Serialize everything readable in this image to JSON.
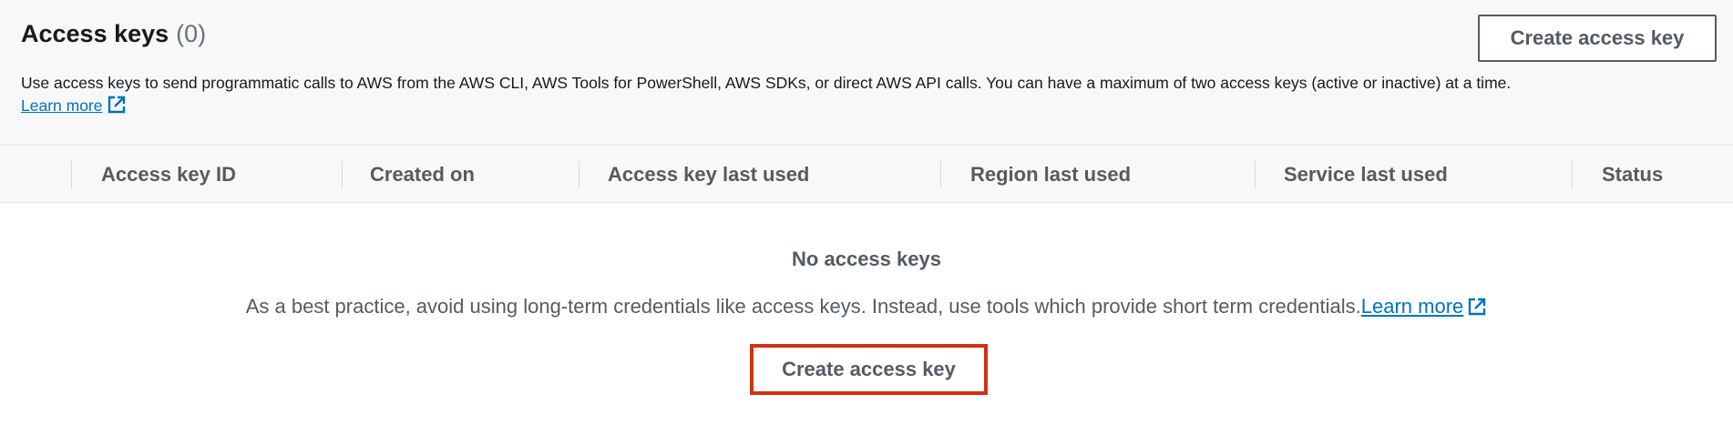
{
  "panel": {
    "title": "Access keys",
    "count": "(0)",
    "create_button_label": "Create access key",
    "description": "Use access keys to send programmatic calls to AWS from the AWS CLI, AWS Tools for PowerShell, AWS SDKs, or direct AWS API calls. You can have a maximum of two access keys (active or inactive) at a time.",
    "learn_more_label": "Learn more"
  },
  "table": {
    "columns": [
      "Access key ID",
      "Created on",
      "Access key last used",
      "Region last used",
      "Service last used",
      "Status"
    ]
  },
  "empty_state": {
    "title": "No access keys",
    "message": "As a best practice, avoid using long-term credentials like access keys. Instead, use tools which provide short term credentials.",
    "learn_more_label": "Learn more",
    "create_button_label": "Create access key"
  },
  "colors": {
    "link": "#0073bb",
    "highlight": "#d13212",
    "header_bg": "#f8f8f8"
  },
  "icons": {
    "external_link": "external-link-icon"
  }
}
